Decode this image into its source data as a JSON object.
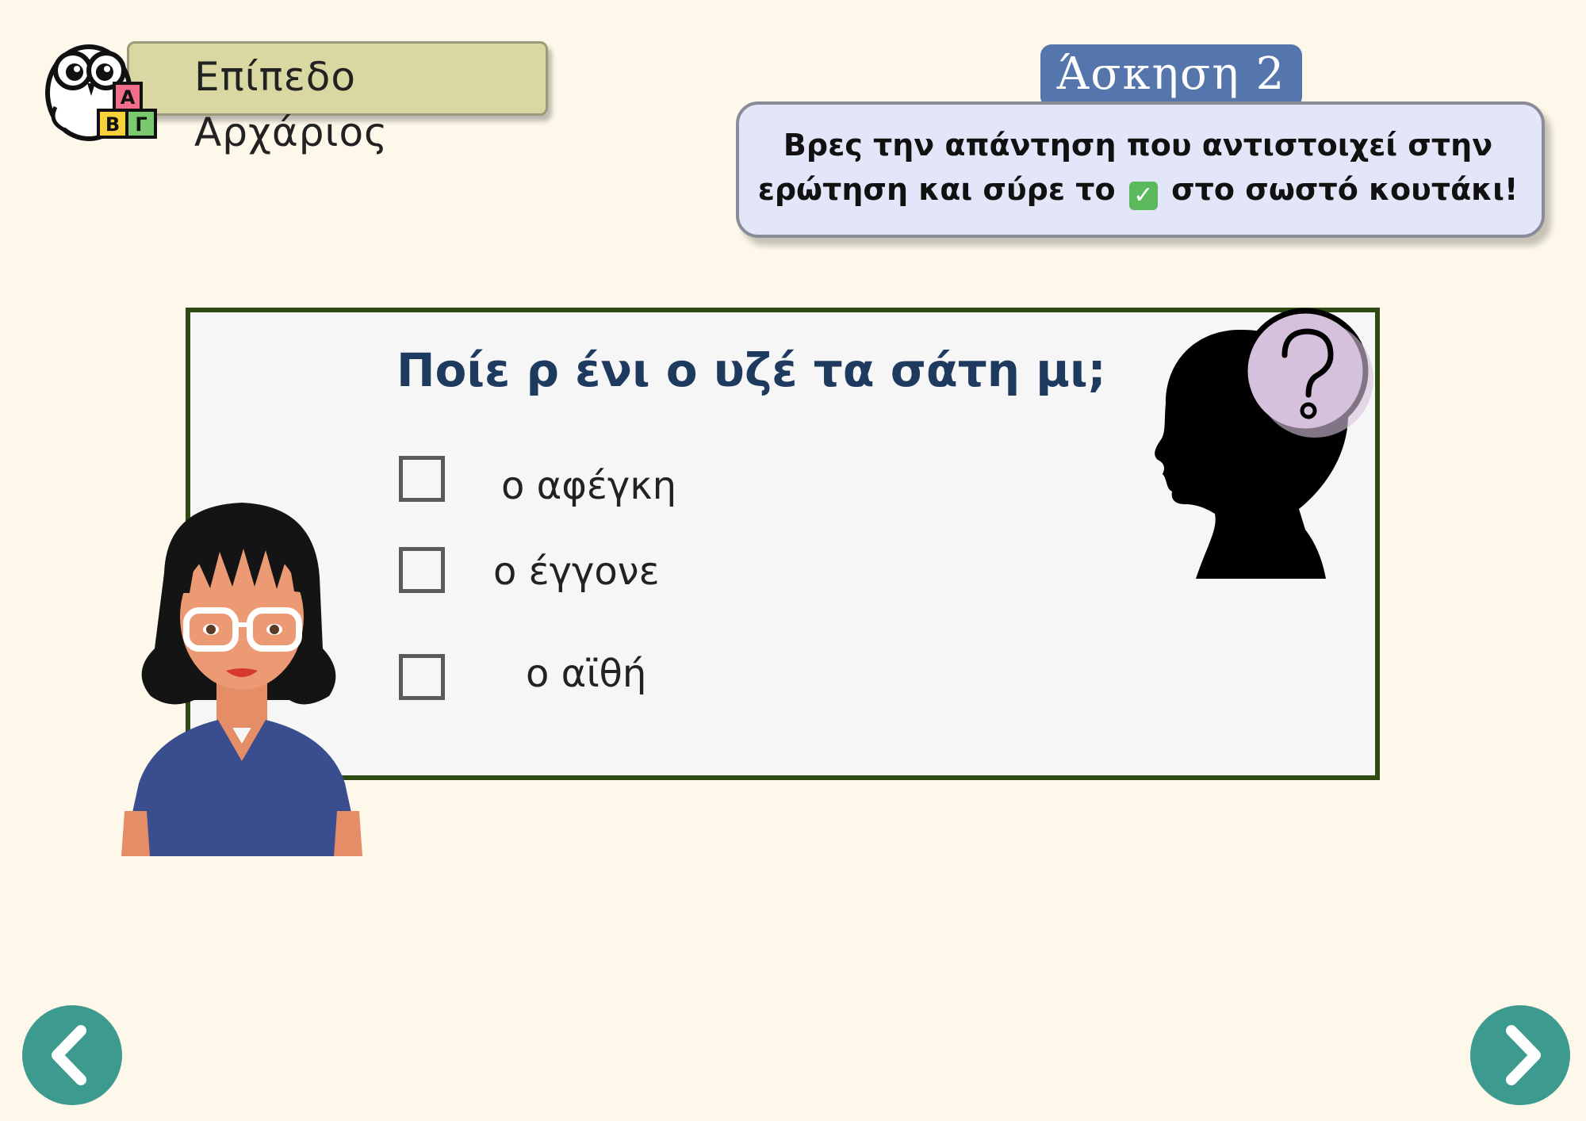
{
  "header": {
    "level_label": "Επίπεδο Αρχάριος",
    "logo_letters": [
      "Α",
      "Β",
      "Γ"
    ],
    "exercise_title": "Άσκηση  2"
  },
  "instruction": {
    "line1": "Βρες την απάντηση που αντιστοιχεί στην",
    "line2_before": "ερώτηση και σύρε το",
    "check_glyph": "✓",
    "line2_after": "στο σωστό κουτάκι!"
  },
  "question": {
    "text": "Ποίε ρ ένι ο υζέ τα σάτη μι;",
    "options": [
      {
        "label": "ο αφέγκη",
        "checked": false
      },
      {
        "label": "ο έγγονε",
        "checked": false
      },
      {
        "label": "ο αϊθή",
        "checked": false
      }
    ]
  },
  "icons": {
    "silhouette": "child-silhouette-question-icon",
    "avatar": "teacher-avatar",
    "prev": "chevron-left-icon",
    "next": "chevron-right-icon"
  },
  "colors": {
    "background": "#fdf8e9",
    "level_badge": "#d9d8a2",
    "exercise_tab": "#5576ad",
    "instruction_box": "#e3e6f8",
    "card_border": "#2e4a12",
    "question_text": "#1f3a5f",
    "nav_button": "#3d9a8f",
    "check": "#5cb85c"
  }
}
